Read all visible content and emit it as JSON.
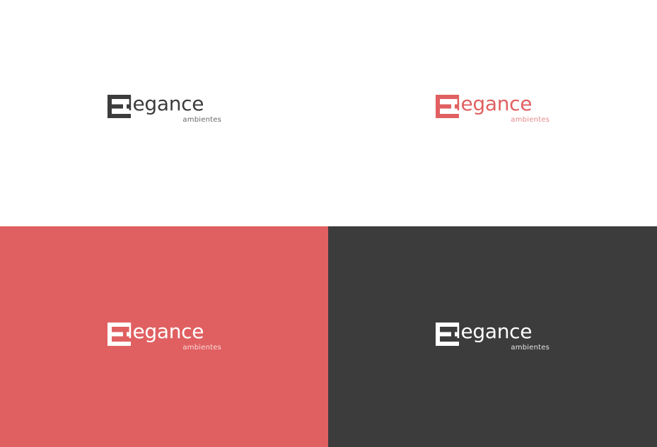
{
  "brand": {
    "name_tail": "legance",
    "tagline": "ambientes",
    "mark_icon": "e-monogram-icon"
  },
  "variants": [
    {
      "id": "dark-on-white",
      "background": "#ffffff",
      "mark_color": "#3d3c3d",
      "text_color": "#3d3c3d",
      "tagline_color": "#666666"
    },
    {
      "id": "coral-on-white",
      "background": "#ffffff",
      "mark_color": "#e06061",
      "text_color": "#e06061",
      "tagline_color": "#e8898a"
    },
    {
      "id": "white-on-coral",
      "background": "#e06061",
      "mark_color": "#ffffff",
      "text_color": "#ffffff",
      "tagline_color": "#fbdcdc"
    },
    {
      "id": "white-on-dark",
      "background": "#3d3c3d",
      "mark_color": "#ffffff",
      "text_color": "#ffffff",
      "tagline_color": "#e6e6e6"
    }
  ]
}
